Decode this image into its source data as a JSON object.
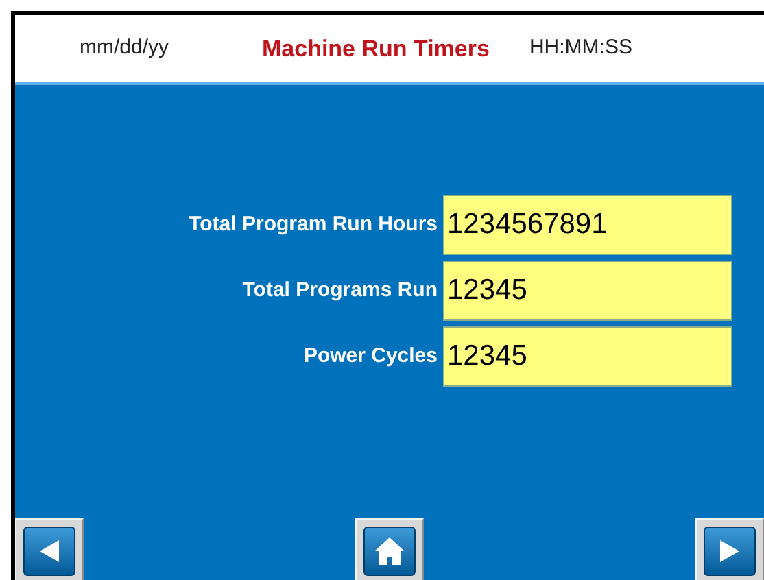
{
  "header": {
    "date": "mm/dd/yy",
    "title": "Machine Run Timers",
    "time": "HH:MM:SS"
  },
  "rows": [
    {
      "label": "Total Program Run Hours",
      "value": "1234567891"
    },
    {
      "label": "Total Programs Run",
      "value": "12345"
    },
    {
      "label": "Power Cycles",
      "value": "12345"
    }
  ],
  "nav_buttons": [
    {
      "kind": "previous"
    },
    {
      "kind": "home"
    },
    {
      "kind": "next"
    }
  ]
}
